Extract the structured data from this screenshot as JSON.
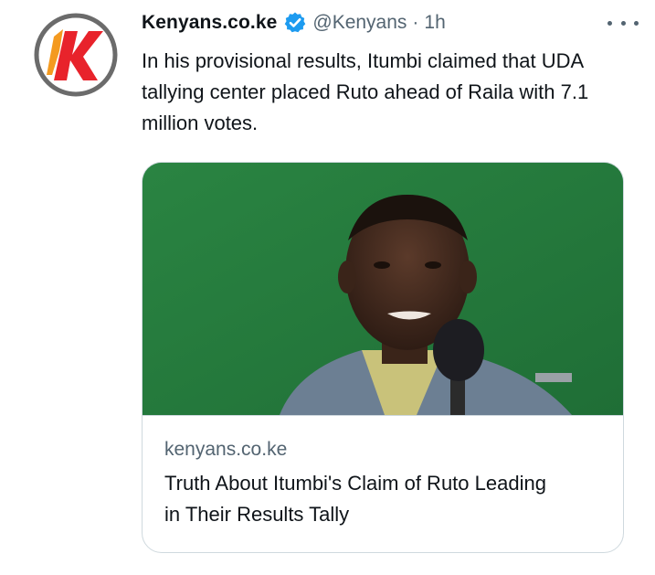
{
  "tweet": {
    "display_name": "Kenyans.co.ke",
    "handle": "@Kenyans",
    "separator": "·",
    "time": "1h",
    "text": "In his provisional results, Itumbi claimed that UDA tallying center placed Ruto ahead of Raila with 7.1 million votes.",
    "verified": true
  },
  "card": {
    "domain": "kenyans.co.ke",
    "title": "Truth About Itumbi's Claim of Ruto Leading in Their Results Tally"
  },
  "icons": {
    "avatar": "kenyans-logo-icon",
    "verified": "verified-badge-icon",
    "more": "more-options-icon"
  },
  "colors": {
    "brand_red": "#e8232b",
    "verified_blue": "#1d9bf0",
    "secondary_text": "#536471",
    "card_border": "#cfd9de",
    "image_background": "#25783d"
  }
}
